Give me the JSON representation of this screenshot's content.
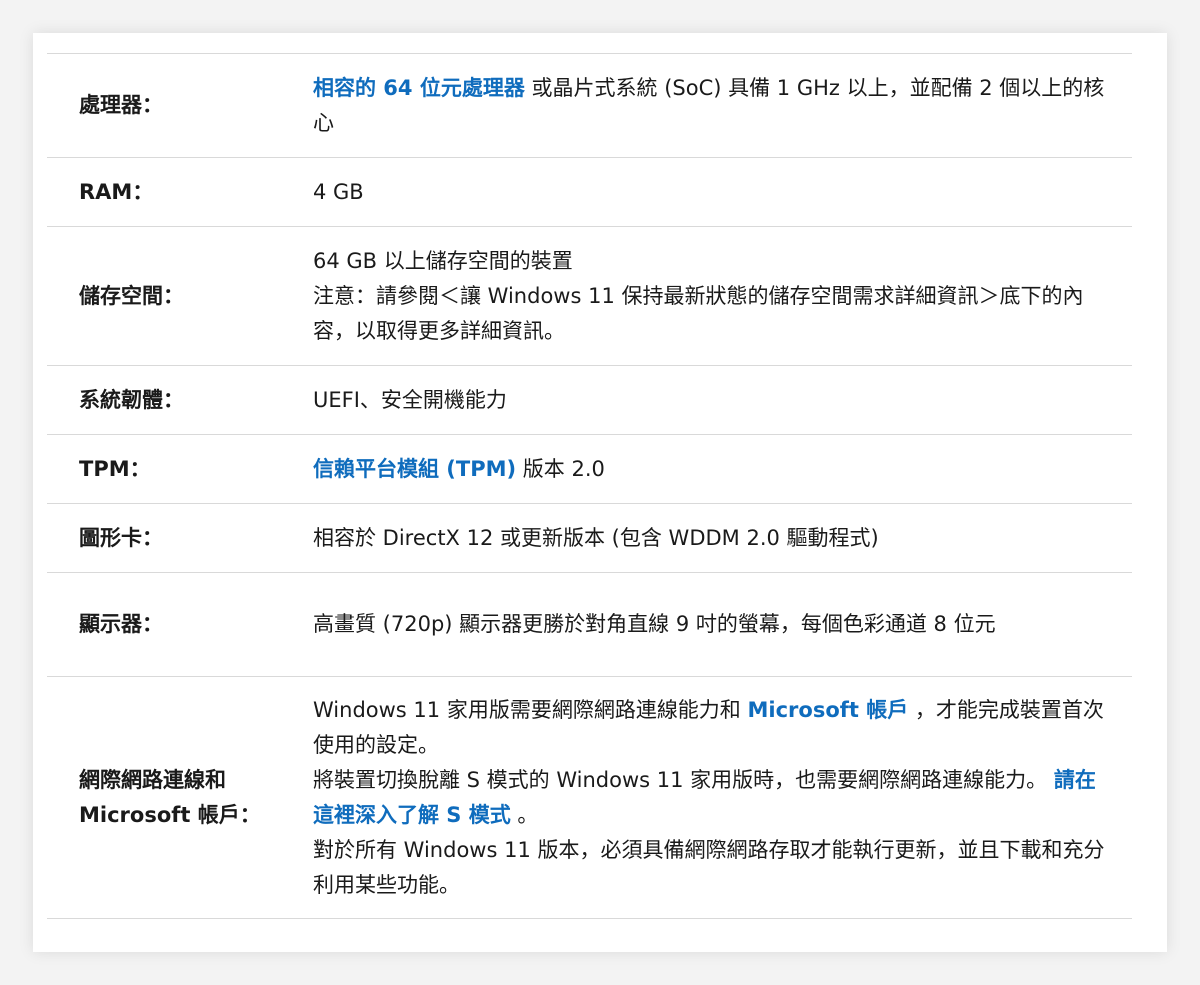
{
  "rows": {
    "cpu": {
      "label": "處理器：",
      "link": "相容的 64 位元處理器",
      "text": " 或晶片式系統 (SoC) 具備 1 GHz 以上，並配備 2 個以上的核心"
    },
    "ram": {
      "label": "RAM：",
      "text": "4 GB"
    },
    "storage": {
      "label": "儲存空間：",
      "line1": "64 GB 以上儲存空間的裝置",
      "line2": "注意：請參閱＜讓 Windows 11 保持最新狀態的儲存空間需求詳細資訊＞底下的內容，以取得更多詳細資訊。"
    },
    "firmware": {
      "label": "系統韌體：",
      "text": "UEFI、安全開機能力"
    },
    "tpm": {
      "label": "TPM：",
      "link": "信賴平台模組 (TPM)",
      "text": " 版本 2.0"
    },
    "gpu": {
      "label": "圖形卡：",
      "text": "相容於 DirectX 12 或更新版本 (包含 WDDM 2.0 驅動程式)"
    },
    "display": {
      "label": "顯示器：",
      "text": "高畫質 (720p) 顯示器更勝於對角直線 9 吋的螢幕，每個色彩通道 8 位元"
    },
    "network": {
      "label_line1": "網際網路連線和",
      "label_line2": "Microsoft 帳戶：",
      "p1_text": "Windows 11 家用版需要網際網路連線能力和 ",
      "p1_link": "Microsoft 帳戶",
      "p1_after": " ，才能完成裝置首次使用的設定。",
      "p2_text": "將裝置切換脫離 S 模式的 Windows 11 家用版時，也需要網際網路連線能力。 ",
      "p2_link": "請在這裡深入了解 S 模式",
      "p2_after": " 。",
      "p3_text": "對於所有 Windows 11 版本，必須具備網際網路存取才能執行更新，並且下載和充分利用某些功能。"
    }
  }
}
